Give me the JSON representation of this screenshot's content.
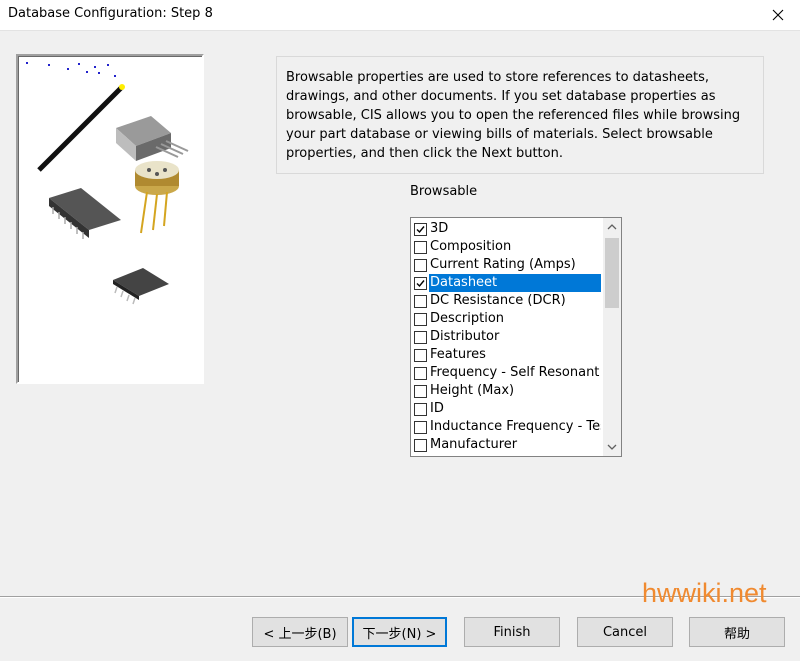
{
  "window": {
    "title": "Database Configuration: Step 8",
    "close_glyph": "✕"
  },
  "description": "Browsable properties are used to store references to datasheets, drawings, and other documents. If you set database properties as browsable, CIS allows you to open the referenced files while browsing your part database or viewing bills of materials. Select browsable properties, and then click the Next button.",
  "browsable": {
    "label": "Browsable",
    "items": [
      {
        "label": "3D",
        "checked": true,
        "selected": false
      },
      {
        "label": "Composition",
        "checked": false,
        "selected": false
      },
      {
        "label": "Current Rating (Amps)",
        "checked": false,
        "selected": false
      },
      {
        "label": "Datasheet",
        "checked": true,
        "selected": true
      },
      {
        "label": "DC Resistance (DCR)",
        "checked": false,
        "selected": false
      },
      {
        "label": "Description",
        "checked": false,
        "selected": false
      },
      {
        "label": "Distributor",
        "checked": false,
        "selected": false
      },
      {
        "label": "Features",
        "checked": false,
        "selected": false
      },
      {
        "label": "Frequency - Self Resonant",
        "checked": false,
        "selected": false
      },
      {
        "label": "Height (Max)",
        "checked": false,
        "selected": false
      },
      {
        "label": "ID",
        "checked": false,
        "selected": false
      },
      {
        "label": "Inductance Frequency - Test",
        "checked": false,
        "selected": false
      },
      {
        "label": "Manufacturer",
        "checked": false,
        "selected": false
      }
    ]
  },
  "buttons": {
    "back": "< 上一步(B)",
    "next": "下一步(N) >",
    "finish": "Finish",
    "cancel": "Cancel",
    "help": "帮助"
  },
  "watermark": "hwwiki.net",
  "colors": {
    "selection": "#0078d7",
    "watermark": "#f08a30"
  }
}
